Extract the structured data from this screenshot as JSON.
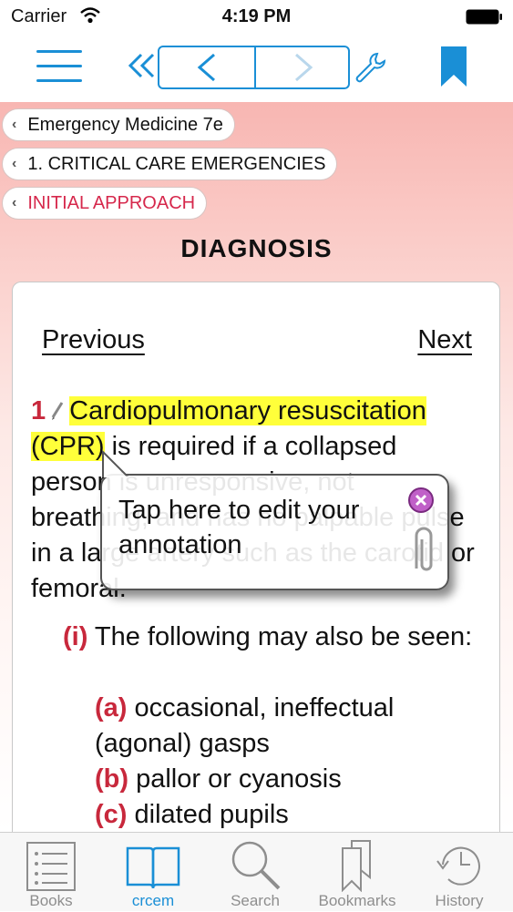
{
  "status_bar": {
    "carrier": "Carrier",
    "time": "4:19 PM"
  },
  "breadcrumbs": [
    {
      "label": "Emergency Medicine 7e"
    },
    {
      "label": "1. CRITICAL CARE EMERGENCIES"
    },
    {
      "label": "INITIAL APPROACH"
    }
  ],
  "page_title": "DIAGNOSIS",
  "pager": {
    "previous": "Previous",
    "next": "Next"
  },
  "section": {
    "number": "1",
    "highlighted_a": "Cardiopulmonary resuscitation",
    "highlighted_b": "(CPR)",
    "text": " is required if a collapsed person is unresponsive, not breathing, and has no palpable pulse in a large artery such as the carotid or femoral."
  },
  "sub_items": {
    "i_marker": "(i)",
    "i_text": " The following may also be seen:",
    "a_marker": "(a)",
    "a_text": " occasional, ineffectual (agonal) gasps",
    "b_marker": "(b)",
    "b_text": " pallor or cyanosis",
    "c_marker": "(c)",
    "c_text": " dilated pupils"
  },
  "tooltip": {
    "text": "Tap here to edit your annotation"
  },
  "tabs": [
    {
      "label": "Books",
      "icon": "list-icon"
    },
    {
      "label": "crcem",
      "icon": "book-icon"
    },
    {
      "label": "Search",
      "icon": "search-icon"
    },
    {
      "label": "Bookmarks",
      "icon": "bookmarks-icon"
    },
    {
      "label": "History",
      "icon": "clock-icon"
    }
  ],
  "colors": {
    "accent": "#1a8fd6",
    "red": "#c8283c",
    "highlight": "#ffff3a"
  }
}
